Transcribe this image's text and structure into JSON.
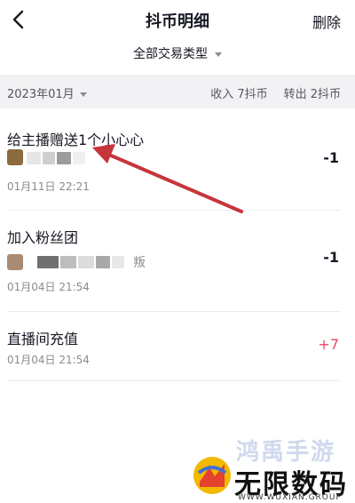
{
  "header": {
    "title": "抖币明细",
    "delete_label": "删除"
  },
  "filter": {
    "label": "全部交易类型"
  },
  "month_bar": {
    "month": "2023年01月",
    "income": "收入 7抖币",
    "outgo": "转出 2抖币"
  },
  "records": [
    {
      "title": "给主播赠送1个小心心",
      "amount": "-1",
      "time": "01月11日 22:21"
    },
    {
      "title": "加入粉丝团",
      "amount": "-1",
      "time": "01月04日 21:54",
      "partial_name": "叛"
    },
    {
      "title": "直播间充值",
      "amount": "+7",
      "time": "01月04日 21:54"
    }
  ],
  "watermark": {
    "top": "鸿禹手游",
    "main": "无限数码",
    "url": "WWW.WUXIAN.GROUP"
  },
  "colors": {
    "positive_amount": "#e7485f",
    "arrow": "#c7343a",
    "month_bar_bg": "#f2f2f4"
  }
}
